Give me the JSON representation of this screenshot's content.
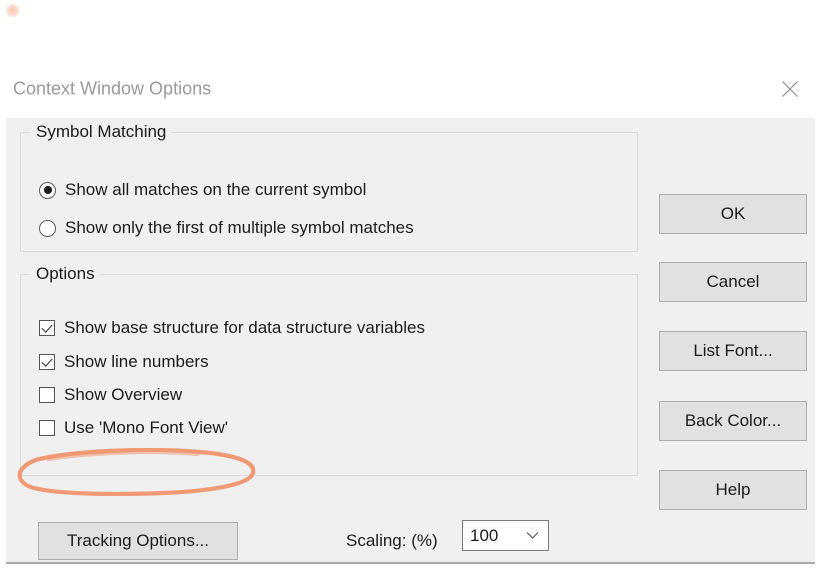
{
  "window": {
    "title": "Context Window Options",
    "close_icon": "close-icon"
  },
  "symbol_matching": {
    "legend": "Symbol Matching",
    "options": [
      {
        "label": "Show all matches on the current symbol",
        "selected": true
      },
      {
        "label": "Show only the first of multiple symbol matches",
        "selected": false
      }
    ]
  },
  "options_group": {
    "legend": "Options",
    "checkboxes": [
      {
        "label": "Show base structure for data structure variables",
        "checked": true
      },
      {
        "label": "Show line numbers",
        "checked": true
      },
      {
        "label": "Show Overview",
        "checked": false
      },
      {
        "label": "Use 'Mono Font View'",
        "checked": false
      }
    ],
    "tracking_options_label": "Tracking Options...",
    "scaling_label": "Scaling: (%)",
    "scaling_value": "100",
    "scaling_arrow_icon": "chevron-down-icon"
  },
  "buttons": {
    "ok": "OK",
    "cancel": "Cancel",
    "list_font": "List Font...",
    "back_color": "Back Color...",
    "help": "Help"
  },
  "annotation": {
    "shape": "hand-drawn-ellipse",
    "targets": "Show line numbers",
    "color": "#f0936a"
  },
  "colors": {
    "dialog_background": "#f0f0f0",
    "titlebar_background": "#ffffff",
    "button_face": "#e1e1e1",
    "button_border": "#adadad",
    "group_border": "#dcdcdc",
    "title_text": "#9a9a9a",
    "body_text": "#1b1b1b",
    "annotation_orange": "#f0936a"
  }
}
